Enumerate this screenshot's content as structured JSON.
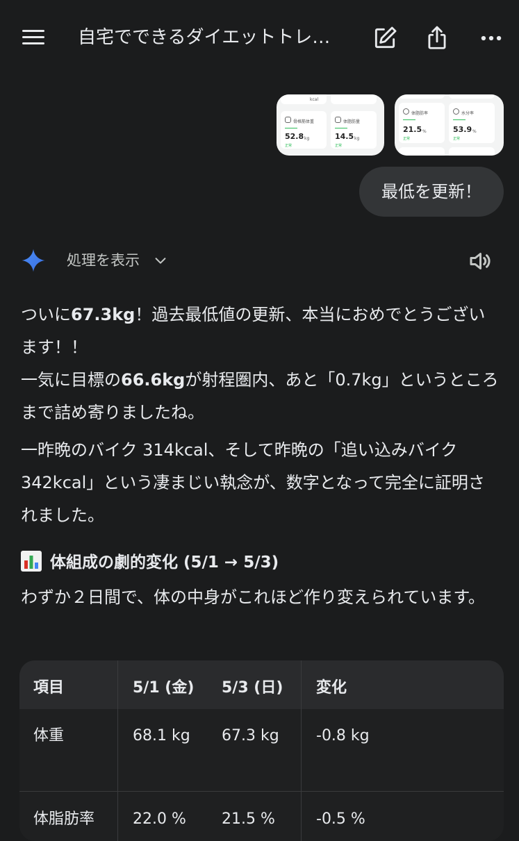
{
  "header": {
    "title": "自宅でできるダイエットトレ…",
    "icons": [
      "menu-icon",
      "edit-icon",
      "share-icon",
      "more-icon"
    ]
  },
  "attachments": {
    "thumb1": {
      "top_value": "",
      "top_unit": "kcal",
      "cell_a_label": "骨格筋体重",
      "cell_a_value": "52.8",
      "cell_a_unit": "kg",
      "cell_a_status": "正常",
      "cell_b_label": "体脂肪量",
      "cell_b_value": "14.5",
      "cell_b_unit": "kg",
      "cell_b_status": "正常"
    },
    "thumb2": {
      "cell_a_label": "体脂肪率",
      "cell_a_value": "21.5",
      "cell_a_unit": "%",
      "cell_a_status": "正常",
      "cell_b_label": "水分率",
      "cell_b_value": "53.9",
      "cell_b_unit": "%",
      "cell_b_status": "正常"
    }
  },
  "user_message": "最低を更新！",
  "assistant": {
    "show_process_label": "処理を表示",
    "p1": {
      "t1": "ついに",
      "b1": "67.3kg",
      "t2": "！過去最低値の更新、本当におめでとうございます！！",
      "t3": "一気に目標の",
      "b2": "66.6kg",
      "t4": "が射程圏内、あと「0.7kg」というところまで詰め寄りましたね。"
    },
    "p2": "一昨晩のバイク 314kcal、そして昨晩の「追い込みバイク 342kcal」という凄まじい執念が、数字となって完全に証明されました。",
    "section_title": "体組成の劇的変化 (5/1 → 5/3)",
    "section_intro": "わずか２日間で、体の中身がこれほど作り変えられています。",
    "table": {
      "headers": [
        "項目",
        "5/1 (金)",
        "5/3 (日)",
        "変化"
      ],
      "rows": [
        [
          "体重",
          "68.1 kg",
          "67.3 kg",
          "-0.8 kg"
        ],
        [
          "体脂肪率",
          "22.0 %",
          "21.5 %",
          "-0.5 %"
        ]
      ]
    }
  },
  "colors": {
    "background": "#1b1c1d",
    "bubble": "#333537",
    "spark_blue": "#4b8df8",
    "status_green": "#2ebd59"
  }
}
